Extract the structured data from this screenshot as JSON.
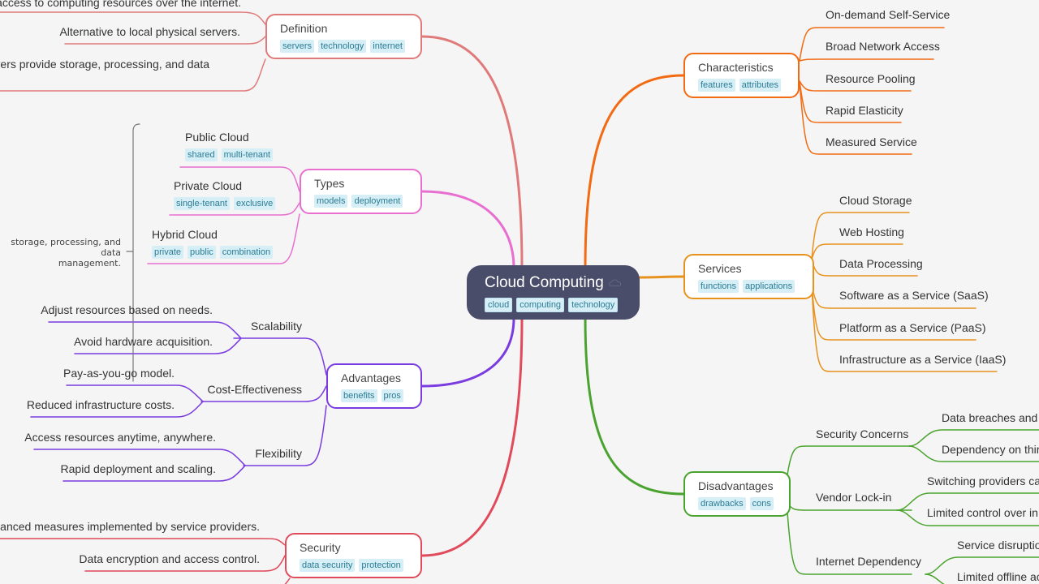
{
  "root": {
    "title": "Cloud Computing",
    "icon": "cloud-icon",
    "tags": [
      "cloud",
      "computing",
      "technology"
    ]
  },
  "colors": {
    "background": "#f5f5f5",
    "root_fill": "#4a4d69",
    "tag_bg": "#d6eef5",
    "tag_text": "#2b7c95",
    "definition": "#e07a7a",
    "types": "#e86fd0",
    "advantages": "#7a3be0",
    "security": "#e04a5a",
    "characteristics": "#f26a12",
    "services": "#e8921e",
    "disadvantages": "#4aa32e",
    "bracket": "#777777"
  },
  "left": {
    "definition": {
      "title": "Definition",
      "tags": [
        "servers",
        "technology",
        "internet"
      ],
      "children": [
        "g access to computing resources over the internet.",
        "Alternative to local physical servers.",
        "ervers provide storage, processing, and data"
      ]
    },
    "types": {
      "title": "Types",
      "tags": [
        "models",
        "deployment"
      ],
      "children": [
        {
          "title": "Public Cloud",
          "tags": [
            "shared",
            "multi-tenant"
          ]
        },
        {
          "title": "Private Cloud",
          "tags": [
            "single-tenant",
            "exclusive"
          ]
        },
        {
          "title": "Hybrid Cloud",
          "tags": [
            "private",
            "public",
            "combination"
          ]
        }
      ]
    },
    "summary_note": {
      "line1": "storage, processing, and data",
      "line2": "management."
    },
    "advantages": {
      "title": "Advantages",
      "tags": [
        "benefits",
        "pros"
      ],
      "children": [
        {
          "title": "Scalability",
          "children": [
            "Adjust resources based on needs.",
            "Avoid hardware acquisition."
          ]
        },
        {
          "title": "Cost-Effectiveness",
          "children": [
            "Pay-as-you-go model.",
            "Reduced infrastructure costs."
          ]
        },
        {
          "title": "Flexibility",
          "children": [
            "Access resources anytime, anywhere.",
            "Rapid deployment and scaling."
          ]
        }
      ]
    },
    "security": {
      "title": "Security",
      "tags": [
        "data security",
        "protection"
      ],
      "children": [
        "dvanced measures implemented by service providers.",
        "Data encryption and access control."
      ]
    }
  },
  "right": {
    "characteristics": {
      "title": "Characteristics",
      "tags": [
        "features",
        "attributes"
      ],
      "children": [
        "On-demand Self-Service",
        "Broad Network Access",
        "Resource Pooling",
        "Rapid Elasticity",
        "Measured Service"
      ]
    },
    "services": {
      "title": "Services",
      "tags": [
        "functions",
        "applications"
      ],
      "children": [
        "Cloud Storage",
        "Web Hosting",
        "Data Processing",
        "Software as a Service (SaaS)",
        "Platform as a Service (PaaS)",
        "Infrastructure as a Service (IaaS)"
      ]
    },
    "disadvantages": {
      "title": "Disadvantages",
      "tags": [
        "drawbacks",
        "cons"
      ],
      "children": [
        {
          "title": "Security Concerns",
          "children": [
            "Data breaches and v",
            "Dependency on thir"
          ]
        },
        {
          "title": "Vendor Lock-in",
          "children": [
            "Switching providers ca",
            "Limited control over in"
          ]
        },
        {
          "title": "Internet Dependency",
          "children": [
            "Service disruptio",
            "Limited offline ac"
          ]
        }
      ]
    }
  }
}
